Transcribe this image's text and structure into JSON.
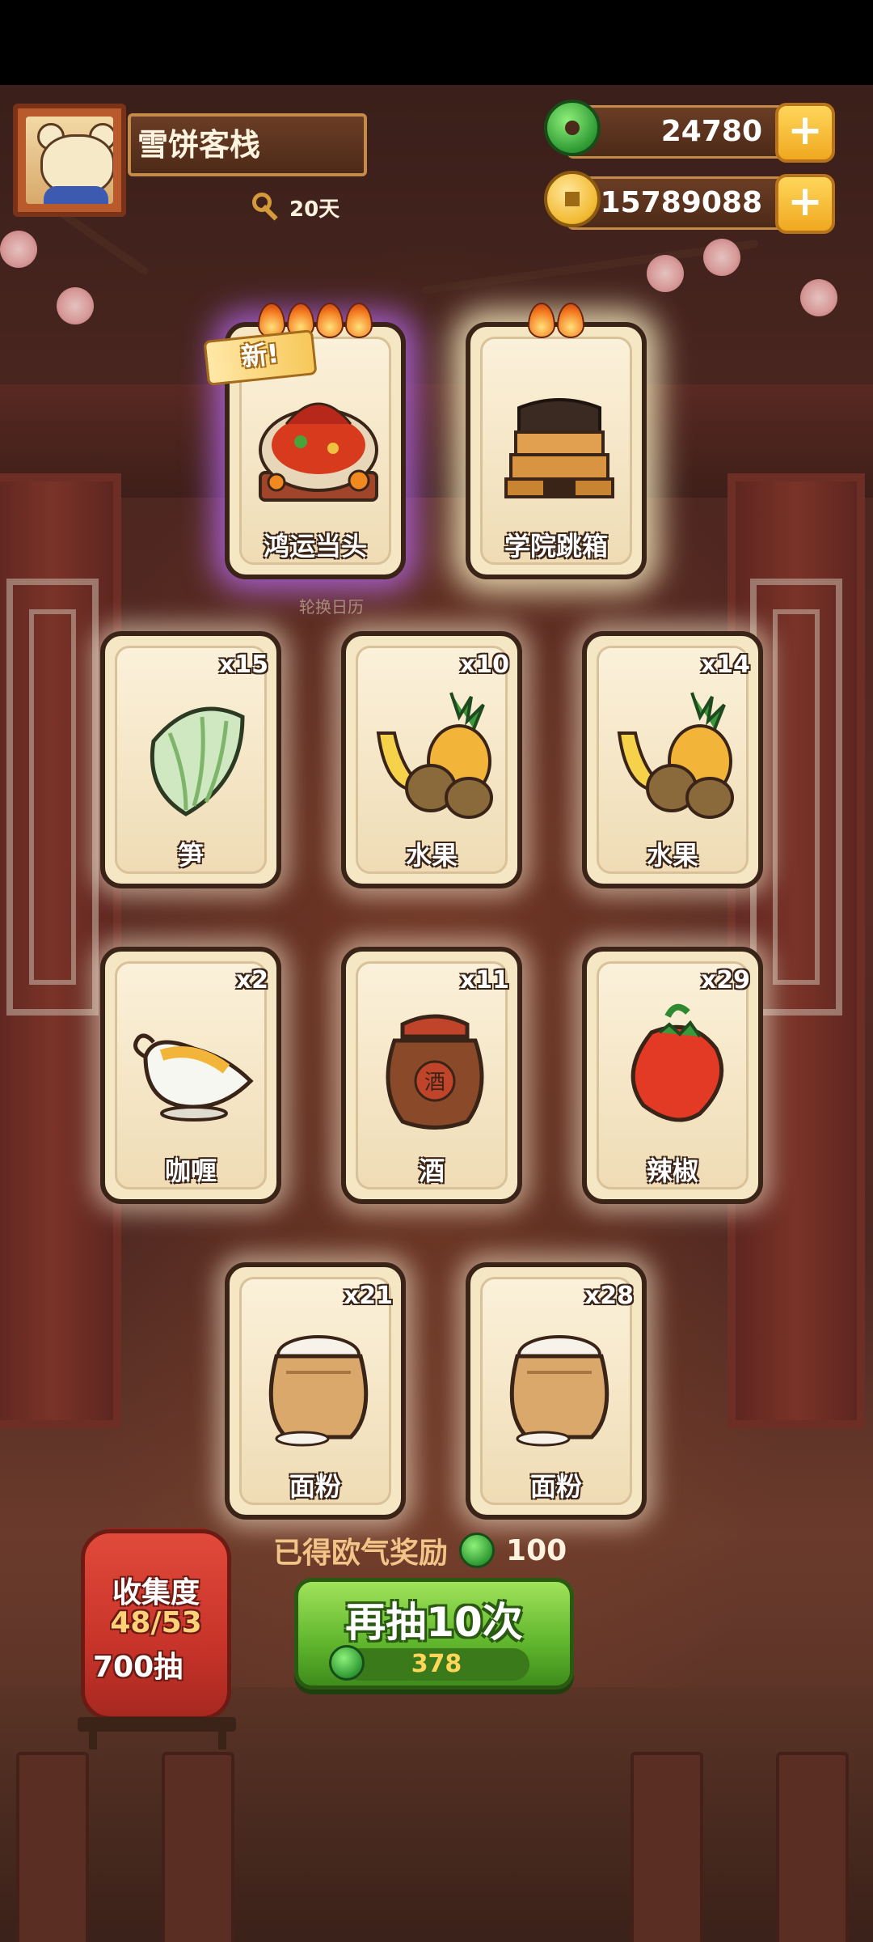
{
  "header": {
    "inn_name": "雪饼客栈",
    "days": "20天",
    "jade_amount": "24780",
    "coin_amount": "15789088",
    "plus_label": "+"
  },
  "featured_cards": [
    {
      "name": "鸿运当头",
      "tag": "新!",
      "flames": 4
    },
    {
      "name": "学院跳箱",
      "flames": 2
    }
  ],
  "calendar_tip": "轮换日历",
  "cards": [
    {
      "name": "笋",
      "count": "x15"
    },
    {
      "name": "水果",
      "count": "x10"
    },
    {
      "name": "水果",
      "count": "x14"
    },
    {
      "name": "咖喱",
      "count": "x2"
    },
    {
      "name": "酒",
      "count": "x11"
    },
    {
      "name": "辣椒",
      "count": "x29"
    },
    {
      "name": "面粉",
      "count": "x21"
    },
    {
      "name": "面粉",
      "count": "x28"
    }
  ],
  "reward": {
    "label": "已得欧气奖励",
    "value": "100"
  },
  "collection": {
    "title": "收集度",
    "progress": "48/53",
    "draws": "700抽"
  },
  "draw_button": {
    "label": "再抽10次",
    "cost": "378"
  },
  "jar_character": "酒",
  "colors": {
    "jade": "#2f9a33",
    "gold": "#f2b930",
    "button_green": "#5fb52c"
  }
}
